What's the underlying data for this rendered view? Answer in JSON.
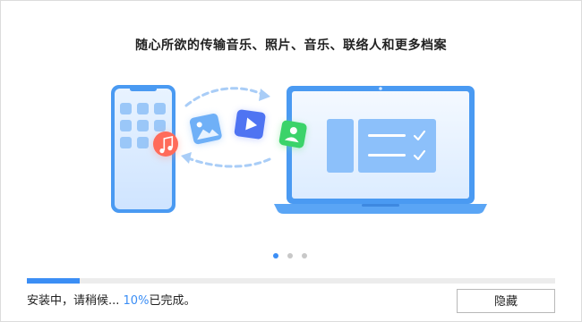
{
  "headline": "随心所欲的传输音乐、照片、音乐、联络人和更多档案",
  "carousel": {
    "pages": 3,
    "active": 0
  },
  "progress": {
    "percent": 10
  },
  "status": {
    "prefix": "安装中，请稍候... ",
    "percent_text": "10%",
    "suffix": "已完成。"
  },
  "hide_button": "隐藏",
  "colors": {
    "accent": "#3b8ef5",
    "music_badge": "#ff6b5a",
    "contact_badge": "#3bd36a"
  },
  "icons": [
    "phone-icon",
    "music-icon",
    "photo-icon",
    "video-icon",
    "contact-icon",
    "laptop-icon",
    "check-icon"
  ]
}
